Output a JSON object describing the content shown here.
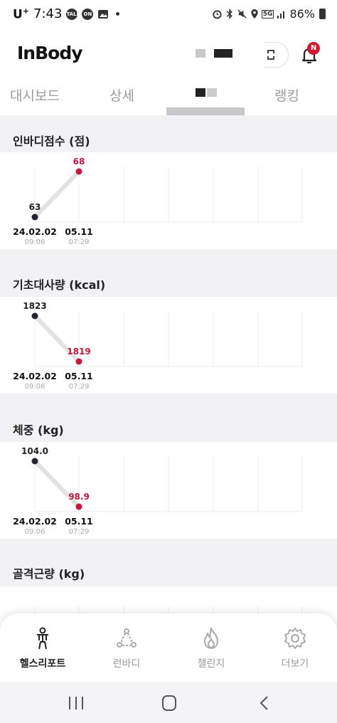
{
  "status_bar": {
    "carrier": "U",
    "carrier_sup": "+",
    "time": "7:43",
    "notif_icons": [
      "talk-icon",
      "on-icon",
      "image-icon"
    ],
    "right_icons": [
      "alarm-icon",
      "bluetooth-icon",
      "mute-icon",
      "location-icon",
      "5g-icon",
      "signal-icon"
    ],
    "battery": "86%"
  },
  "app_bar": {
    "logo": "InBody",
    "qr_icon": "qr-code-icon",
    "bell_icon": "bell-icon",
    "bell_badge": "N"
  },
  "tabs": [
    {
      "label": "대시보드"
    },
    {
      "label": "상세"
    },
    {
      "label": ""
    },
    {
      "label": "랭킹"
    }
  ],
  "colors": {
    "accent_red": "#c8173a",
    "dark_point": "#222233",
    "line": "#e2e2e2",
    "background": "#f2f2f4"
  },
  "sections": [
    {
      "title": "인바디점수 (점)",
      "chart_data": {
        "type": "line",
        "title": "인바디점수 (점)",
        "x": [
          "24.02.02",
          "05.11"
        ],
        "x_sub": [
          "09:06",
          "07:29"
        ],
        "series": [
          {
            "values": [
              63,
              68
            ]
          }
        ],
        "value_labels": [
          "63",
          "68"
        ],
        "ylim": [
          63,
          68
        ]
      }
    },
    {
      "title": "기초대사량 (kcal)",
      "chart_data": {
        "type": "line",
        "title": "기초대사량 (kcal)",
        "x": [
          "24.02.02",
          "05.11"
        ],
        "x_sub": [
          "09:06",
          "07:29"
        ],
        "series": [
          {
            "values": [
              1823,
              1819
            ]
          }
        ],
        "value_labels": [
          "1823",
          "1819"
        ],
        "ylim": [
          1819,
          1823
        ]
      }
    },
    {
      "title": "체중 (kg)",
      "chart_data": {
        "type": "line",
        "title": "체중 (kg)",
        "x": [
          "24.02.02",
          "05.11"
        ],
        "x_sub": [
          "09:06",
          "07:29"
        ],
        "series": [
          {
            "values": [
              104.0,
              98.9
            ]
          }
        ],
        "value_labels": [
          "104.0",
          "98.9"
        ],
        "ylim": [
          98.9,
          104.0
        ]
      }
    },
    {
      "title": "골격근량 (kg)"
    }
  ],
  "bottom_nav": [
    {
      "label": "헬스리포트",
      "icon": "health-report-icon",
      "active": true
    },
    {
      "label": "런바디",
      "icon": "runbody-icon",
      "active": false
    },
    {
      "label": "챌린지",
      "icon": "flame-icon",
      "active": false
    },
    {
      "label": "더보기",
      "icon": "gear-icon",
      "active": false
    }
  ],
  "system_nav": [
    "recents-icon",
    "home-icon",
    "back-icon"
  ]
}
